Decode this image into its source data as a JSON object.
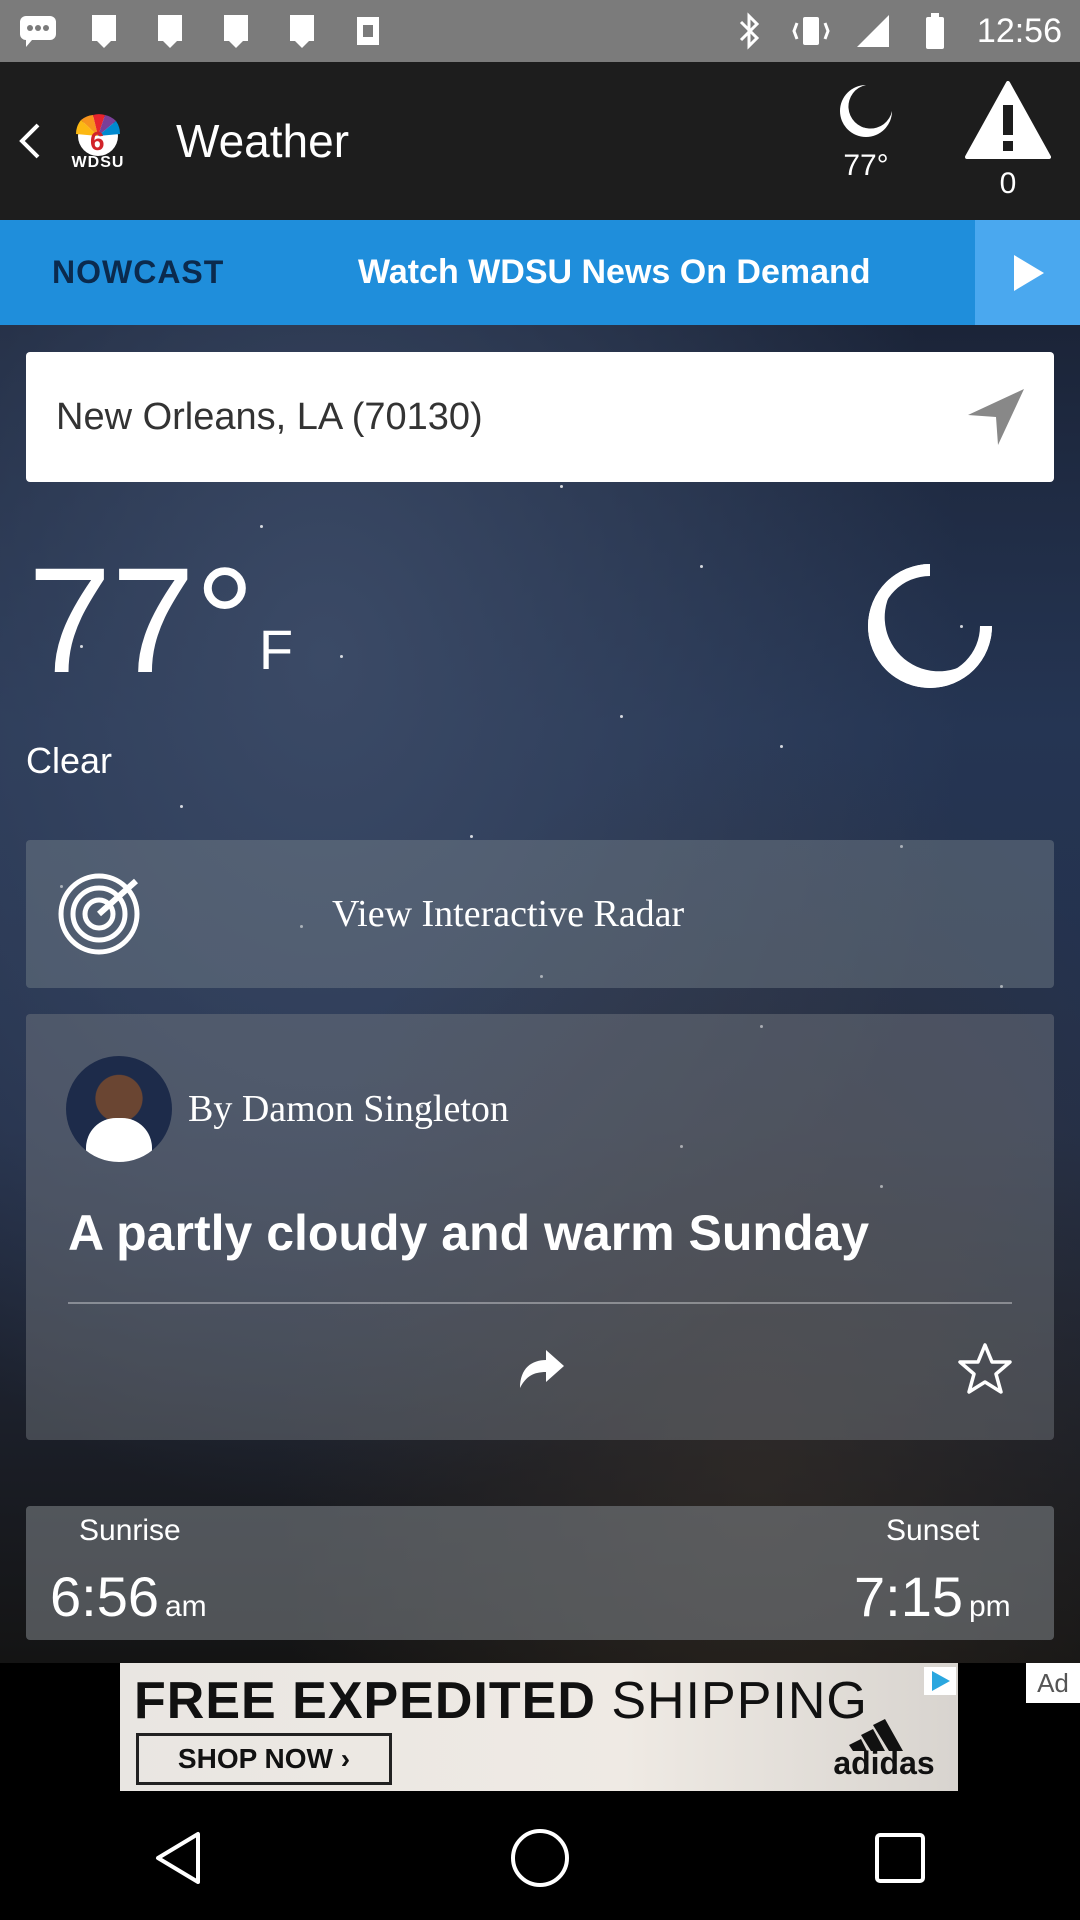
{
  "status_bar": {
    "time": "12:56",
    "icons": [
      "chat-icon",
      "notification-icon",
      "notification-icon",
      "notification-icon",
      "notification-icon",
      "download-icon",
      "bluetooth-icon",
      "vibrate-icon",
      "signal-icon",
      "battery-icon"
    ]
  },
  "app_bar": {
    "logo_text": "WDSU",
    "title": "Weather",
    "current_temp": "77°",
    "alerts_count": "0"
  },
  "nowcast_bar": {
    "label": "NOWCAST",
    "promo": "Watch WDSU News On Demand"
  },
  "location": {
    "text": "New Orleans, LA (70130)"
  },
  "current": {
    "temp": "77°",
    "unit": "F",
    "condition": "Clear"
  },
  "radar": {
    "label": "View Interactive Radar"
  },
  "article": {
    "author": "By Damon Singleton",
    "headline": "A partly cloudy and warm Sunday"
  },
  "sun": {
    "sunrise_label": "Sunrise",
    "sunrise_time": "6:56",
    "sunrise_suffix": "am",
    "sunset_label": "Sunset",
    "sunset_time": "7:15",
    "sunset_suffix": "pm"
  },
  "ad": {
    "headline_bold": "FREE EXPEDITED",
    "headline_thin": " SHIPPING",
    "cta": "SHOP NOW ›",
    "brand": "adidas",
    "tag": "Ad"
  },
  "colors": {
    "nowcast_blue": "#1f8edb",
    "nowcast_label": "#0b2a4d",
    "app_bar": "#1d1d1d",
    "status_bar": "#7b7b7b"
  }
}
